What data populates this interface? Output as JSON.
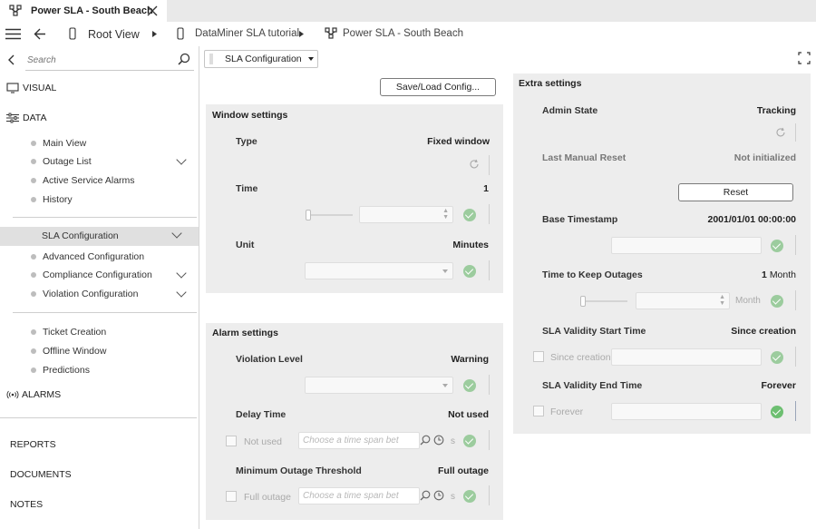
{
  "tab": {
    "title": "Power SLA - South Beach"
  },
  "breadcrumb": {
    "root": "Root View",
    "level1": "DataMiner SLA tutorial",
    "level2": "Power SLA - South Beach"
  },
  "sidebar": {
    "search_placeholder": "Search",
    "visual": "VISUAL",
    "data": "DATA",
    "group1": [
      "Main View",
      "Outage List",
      "Active Service Alarms",
      "History"
    ],
    "selected": "SLA Configuration",
    "group2": [
      "Advanced Configuration",
      "Compliance Configuration",
      "Violation Configuration"
    ],
    "group3": [
      "Ticket Creation",
      "Offline Window",
      "Predictions"
    ],
    "alarms": "ALARMS",
    "reports": "REPORTS",
    "documents": "DOCUMENTS",
    "notes": "NOTES"
  },
  "page_select": {
    "value": "SLA Configuration"
  },
  "save_load_button": "Save/Load Config...",
  "window_settings": {
    "title": "Window settings",
    "type_label": "Type",
    "type_value": "Fixed window",
    "time_label": "Time",
    "time_value": "1",
    "unit_label": "Unit",
    "unit_value": "Minutes"
  },
  "alarm_settings": {
    "title": "Alarm settings",
    "violation_label": "Violation Level",
    "violation_value": "Warning",
    "delay_label": "Delay Time",
    "delay_value": "Not used",
    "delay_checkbox": "Not used",
    "delay_placeholder": "Choose a time span between",
    "delay_unit": "s",
    "threshold_label": "Minimum Outage Threshold",
    "threshold_value": "Full outage",
    "threshold_checkbox": "Full outage",
    "threshold_placeholder": "Choose a time span between",
    "threshold_unit": "s"
  },
  "extra_settings": {
    "title": "Extra settings",
    "admin_label": "Admin State",
    "admin_value": "Tracking",
    "reset_label": "Last Manual Reset",
    "reset_value": "Not initialized",
    "reset_button": "Reset",
    "base_label": "Base Timestamp",
    "base_value": "2001/01/01 00:00:00",
    "keep_label": "Time to Keep Outages",
    "keep_value_num": "1",
    "keep_value_unit": "Month",
    "keep_unit_field": "Month",
    "start_label": "SLA Validity Start Time",
    "start_value": "Since creation",
    "start_checkbox": "Since creation",
    "end_label": "SLA Validity End Time",
    "end_value": "Forever",
    "end_checkbox": "Forever"
  },
  "colors": {
    "panel": "#ededed",
    "selected": "#e0e0e0",
    "check": "#9ccc9e",
    "tabbar": "#e9e9e9"
  }
}
